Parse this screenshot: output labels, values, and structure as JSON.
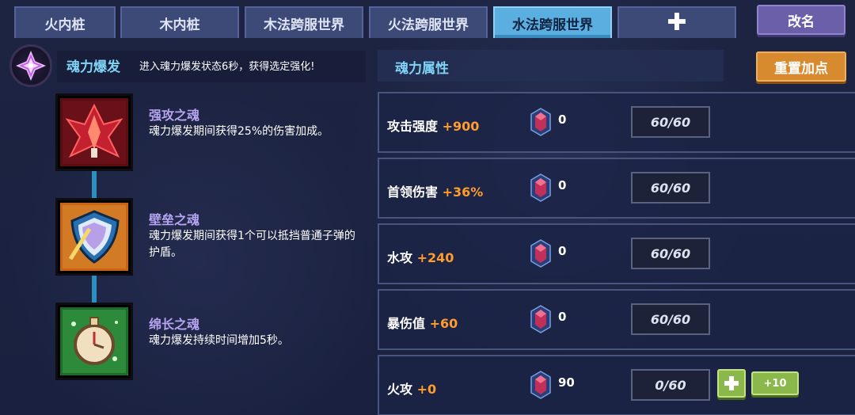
{
  "tabs": [
    {
      "label": "火内桩",
      "active": false
    },
    {
      "label": "木内桩",
      "active": false
    },
    {
      "label": "木法跨服世界",
      "active": false
    },
    {
      "label": "火法跨服世界",
      "active": false
    },
    {
      "label": "水法跨服世界",
      "active": true
    }
  ],
  "add_tab_icon": "plus-icon",
  "rename_label": "改名",
  "burst": {
    "title": "魂力爆发",
    "description": "进入魂力爆发状态6秒，获得选定强化!"
  },
  "souls": [
    {
      "name": "强攻之魂",
      "desc": "魂力爆发期间获得25%的伤害加成。",
      "icon": "red-dragon-icon"
    },
    {
      "name": "壁垒之魂",
      "desc": "魂力爆发期间获得1个可以抵挡普通子弹的护盾。",
      "icon": "shield-icon"
    },
    {
      "name": "绵长之魂",
      "desc": "魂力爆发持续时间增加5秒。",
      "icon": "stopwatch-icon"
    }
  ],
  "attributes": {
    "title": "魂力属性",
    "reset_label": "重置加点",
    "rows": [
      {
        "name": "攻击强度",
        "bonus": "+900",
        "gems": "0",
        "level": "60/60"
      },
      {
        "name": "首领伤害",
        "bonus": "+36%",
        "gems": "0",
        "level": "60/60"
      },
      {
        "name": "水攻",
        "bonus": "+240",
        "gems": "0",
        "level": "60/60"
      },
      {
        "name": "暴伤值",
        "bonus": "+60",
        "gems": "0",
        "level": "60/60"
      },
      {
        "name": "火攻",
        "bonus": "+0",
        "gems": "90",
        "level": "0/60",
        "plus10_label": "+10"
      }
    ]
  },
  "colors": {
    "accent_cyan": "#7fd4f5",
    "bonus_orange": "#ff9c2e",
    "soul_name_purple": "#b7a4f0",
    "active_tab": "#5aaee0",
    "reset_orange": "#d88a2e",
    "plus_green": "#8ab84a"
  }
}
